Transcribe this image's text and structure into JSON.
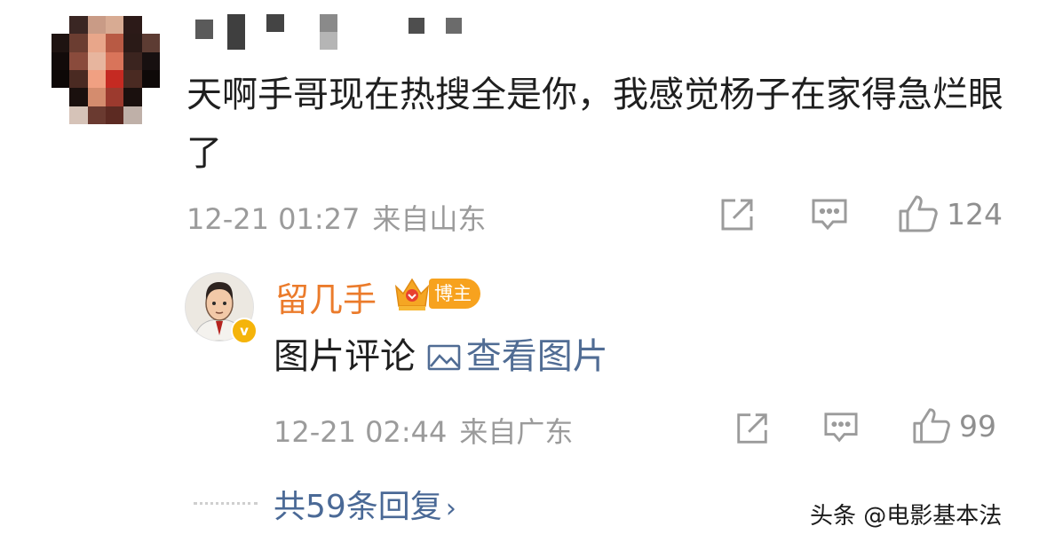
{
  "comment": {
    "text": "天啊手哥现在热搜全是你，我感觉杨子在家得急烂眼了",
    "date": "12-21 01:27",
    "location": "来自山东",
    "like_count": "124"
  },
  "reply": {
    "author": "留几手",
    "badge": "博主",
    "verified_mark": "v",
    "text": "图片评论",
    "view_image": "查看图片",
    "date": "12-21 02:44",
    "location": "来自广东",
    "like_count": "99"
  },
  "more_replies": {
    "label": "共59条回复",
    "chevron": "›"
  },
  "watermark": "头条 @电影基本法",
  "icons": [
    "share-icon",
    "comment-icon",
    "like-icon",
    "image-icon",
    "crown-icon"
  ],
  "colors": {
    "author_name": "#eb7b2b",
    "badge": "#f7a21e",
    "link": "#4a6996",
    "meta_gray": "#9b9b9b"
  }
}
